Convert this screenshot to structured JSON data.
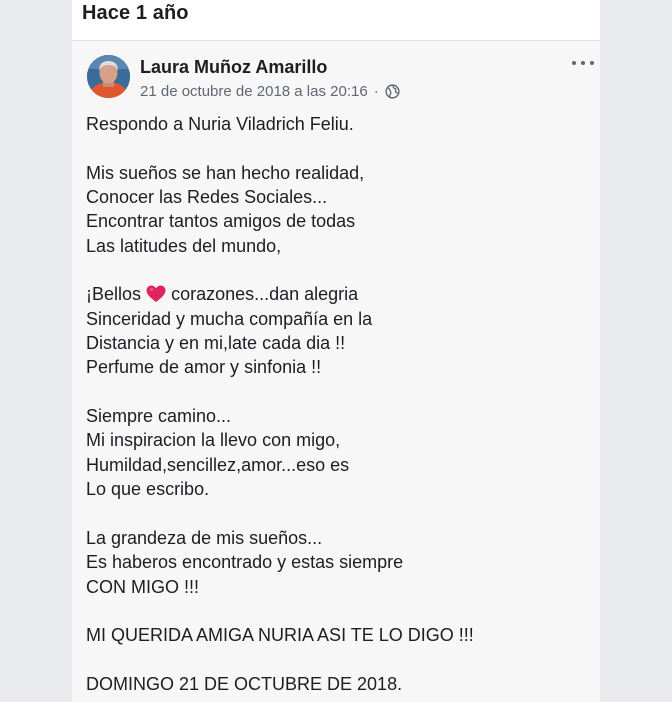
{
  "section": {
    "title": "Hace 1 año"
  },
  "post": {
    "author": "Laura Muñoz Amarillo",
    "timestamp": "21 de octubre de 2018 a las 20:16",
    "separator": "·",
    "privacy_icon": "globe-icon",
    "menu_icon": "more-options-icon",
    "lines": {
      "l1": "Respondo a Nuria Viladrich Feliu.",
      "l2": "Mis sueños se han hecho realidad,",
      "l3": "Conocer las Redes Sociales...",
      "l4": "Encontrar tantos amigos de todas",
      "l5": "Las latitudes del mundo,",
      "l6a": "¡Bellos",
      "l6b": "corazones...dan alegria",
      "l7": "Sinceridad y mucha compañía en la",
      "l8": "Distancia y en mi,late cada dia !!",
      "l9": "Perfume de amor y sinfonia !!",
      "l10": "Siempre camino...",
      "l11": "Mi inspiracion la llevo con migo,",
      "l12": "Humildad,sencillez,amor...eso es",
      "l13": "Lo que escribo.",
      "l14": "La grandeza de mis sueños...",
      "l15": "Es haberos encontrado y estas siempre",
      "l16": "CON MIGO !!!",
      "l17": "MI QUERIDA AMIGA NURIA ASI TE LO DIGO !!!",
      "l18": "DOMINGO 21 DE OCTUBRE DE 2018."
    },
    "emoji": "heart-emoji"
  },
  "colors": {
    "text": "#1c1e21",
    "secondary_text": "#606770",
    "card_background": "#f7f7f8",
    "page_background": "#e9ebee",
    "heart": "#e0245e"
  }
}
